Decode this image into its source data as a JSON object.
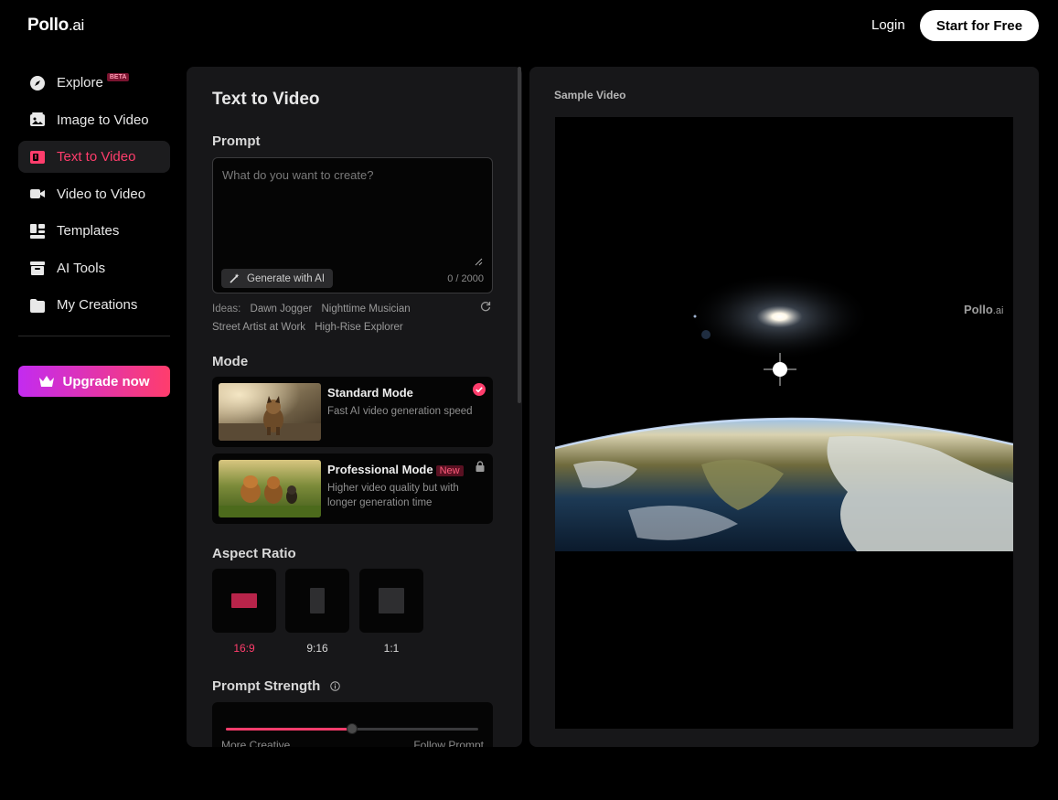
{
  "header": {
    "logo_main": "Pollo",
    "logo_suffix": ".ai",
    "login_label": "Login",
    "start_label": "Start for Free"
  },
  "sidebar": {
    "items": [
      {
        "label": "Explore",
        "badge": "BETA",
        "icon": "compass-icon"
      },
      {
        "label": "Image to Video",
        "icon": "image-video-icon"
      },
      {
        "label": "Text to Video",
        "icon": "text-video-icon",
        "active": true
      },
      {
        "label": "Video to Video",
        "icon": "video-camera-icon"
      },
      {
        "label": "Templates",
        "icon": "templates-grid-icon"
      },
      {
        "label": "AI Tools",
        "icon": "toolbox-icon"
      },
      {
        "label": "My Creations",
        "icon": "folder-icon"
      }
    ],
    "upgrade_label": "Upgrade now"
  },
  "panel": {
    "title": "Text to Video",
    "prompt_label": "Prompt",
    "prompt_placeholder": "What do you want to create?",
    "prompt_value": "",
    "generate_ai_label": "Generate with AI",
    "char_count": "0 / 2000",
    "ideas_label": "Ideas:",
    "ideas": [
      "Dawn Jogger",
      "Nighttime Musician",
      "Street Artist at Work",
      "High-Rise Explorer"
    ],
    "mode_label": "Mode",
    "modes": [
      {
        "name": "Standard Mode",
        "desc": "Fast AI video generation speed",
        "selected": true
      },
      {
        "name": "Professional Mode",
        "badge": "New",
        "desc": "Higher video quality but with longer generation time",
        "locked": true
      }
    ],
    "aspect_label": "Aspect Ratio",
    "aspect_ratios": [
      {
        "label": "16:9",
        "selected": true
      },
      {
        "label": "9:16"
      },
      {
        "label": "1:1"
      }
    ],
    "strength_label": "Prompt Strength",
    "strength_left": "More Creative",
    "strength_right": "Follow Prompt",
    "strength_value": 0.5
  },
  "sample": {
    "title": "Sample Video",
    "watermark_main": "Pollo",
    "watermark_suffix": ".ai"
  },
  "colors": {
    "accent": "#ff3d6c",
    "upgrade_gradient_start": "#c32bf0",
    "upgrade_gradient_end": "#ff3d6c",
    "panel_bg": "#171719"
  }
}
